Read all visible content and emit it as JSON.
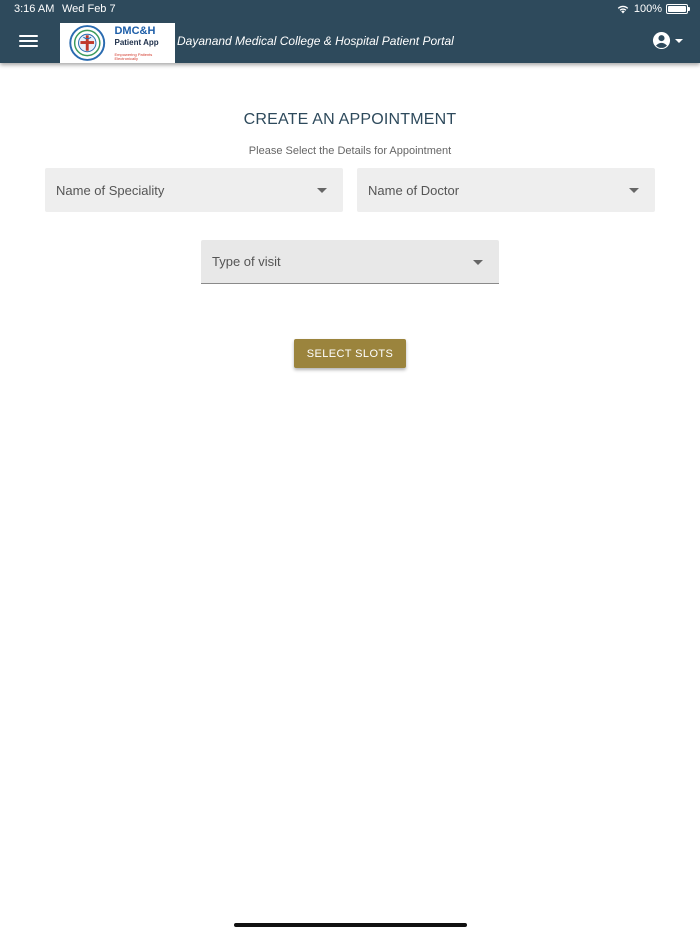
{
  "status_bar": {
    "time": "3:16 AM",
    "date": "Wed Feb 7",
    "battery": "100%",
    "battery_level": 1.0
  },
  "header": {
    "menu_icon": "hamburger-menu-icon",
    "logo": {
      "title": "DMC&H",
      "subtitle": "Patient App",
      "tagline": "Empowering Patients Electronically"
    },
    "portal_title": "Dayanand Medical College & Hospital Patient Portal",
    "account_icon": "account-circle-icon"
  },
  "main": {
    "heading": "CREATE AN APPOINTMENT",
    "subheading": "Please Select the Details for Appointment",
    "fields": {
      "speciality": {
        "label": "Name of Speciality"
      },
      "doctor": {
        "label": "Name of Doctor"
      },
      "visit_type": {
        "label": "Type of visit"
      }
    },
    "select_slots_label": "SELECT SLOTS"
  },
  "colors": {
    "appbar": "#2e4a5c",
    "heading": "#2e4a5c",
    "button": "#9b843d",
    "field_bg": "#eeeeee"
  }
}
